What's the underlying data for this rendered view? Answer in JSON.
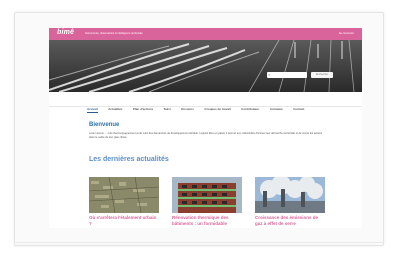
{
  "header": {
    "logo": "bimê",
    "tagline": "Instruments, observatoire & intelligence territoriale",
    "top_right": "Se connecter"
  },
  "search": {
    "placeholder": "",
    "button": "Rechercher"
  },
  "nav": {
    "items": [
      "Accueil",
      "Actualités",
      "Plan d'actions",
      "Suivi",
      "Dossiers",
      "Groupes de travail",
      "Contributeur",
      "Annuaire",
      "Contact"
    ],
    "active": "Accueil"
  },
  "welcome": {
    "title": "Bienvenue",
    "text": "Lorem ipsum ... outil d'accompagnement et de suivi des démarches de développement durable. Logiciel libre et gratuit, il permet aux collectivités d'animer leur démarche territoriale et de suivre les actions dans le cadre de leur plan climat."
  },
  "news": {
    "title": "Les dernières actualités",
    "items": [
      {
        "caption": "Où s'arrêtera l'étalement urbain ?"
      },
      {
        "caption": "Rénovation thermique des bâtiments : un formidable"
      },
      {
        "caption": "Croissance des émissions de gaz à effet de serre"
      }
    ]
  },
  "colors": {
    "brand_pink": "#d9649b",
    "title_blue": "#2d74a9",
    "news_blue": "#5a8fc7",
    "nav_active": "#2b5a93"
  }
}
